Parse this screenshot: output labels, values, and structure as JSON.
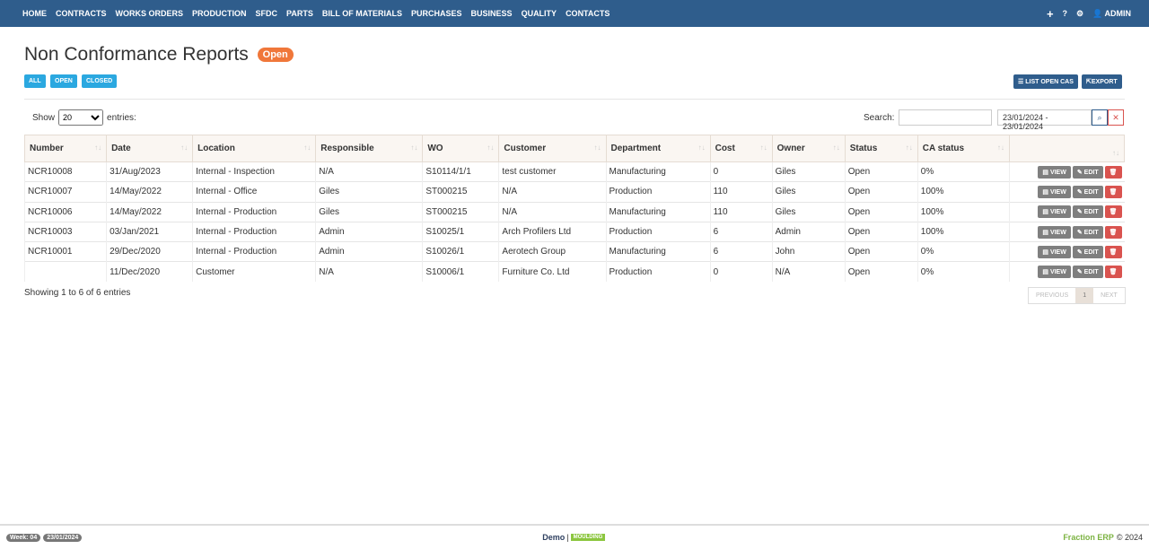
{
  "nav": {
    "items": [
      "HOME",
      "CONTRACTS",
      "WORKS ORDERS",
      "PRODUCTION",
      "SFDC",
      "PARTS",
      "BILL OF MATERIALS",
      "PURCHASES",
      "BUSINESS",
      "QUALITY",
      "CONTACTS"
    ],
    "user": "ADMIN"
  },
  "page": {
    "title": "Non Conformance Reports",
    "badge": "Open",
    "filters": [
      "ALL",
      "OPEN",
      "CLOSED"
    ],
    "list_open_cas": "LIST OPEN CAS",
    "export": "EXPORT"
  },
  "controls": {
    "show": "Show",
    "entries_value": "20",
    "entries": "entries:",
    "search": "Search:",
    "date_range": "23/01/2024 - 23/01/2024"
  },
  "table": {
    "headers": [
      "Number",
      "Date",
      "Location",
      "Responsible",
      "WO",
      "Customer",
      "Department",
      "Cost",
      "Owner",
      "Status",
      "CA status"
    ],
    "rows": [
      [
        "NCR10008",
        "31/Aug/2023",
        "Internal - Inspection",
        "N/A",
        "S10114/1/1",
        "test customer",
        "Manufacturing",
        "0",
        "Giles",
        "Open",
        "0%"
      ],
      [
        "NCR10007",
        "14/May/2022",
        "Internal - Office",
        "Giles",
        "ST000215",
        "N/A",
        "Production",
        "110",
        "Giles",
        "Open",
        "100%"
      ],
      [
        "NCR10006",
        "14/May/2022",
        "Internal - Production",
        "Giles",
        "ST000215",
        "N/A",
        "Manufacturing",
        "110",
        "Giles",
        "Open",
        "100%"
      ],
      [
        "NCR10003",
        "03/Jan/2021",
        "Internal - Production",
        "Admin",
        "S10025/1",
        "Arch Profilers Ltd",
        "Production",
        "6",
        "Admin",
        "Open",
        "100%"
      ],
      [
        "NCR10001",
        "29/Dec/2020",
        "Internal - Production",
        "Admin",
        "S10026/1",
        "Aerotech Group",
        "Manufacturing",
        "6",
        "John",
        "Open",
        "0%"
      ],
      [
        "",
        "11/Dec/2020",
        "Customer",
        "N/A",
        "S10006/1",
        "Furniture Co. Ltd",
        "Production",
        "0",
        "N/A",
        "Open",
        "0%"
      ]
    ],
    "view": "VIEW",
    "edit": "EDIT"
  },
  "info": "Showing 1 to 6 of 6 entries",
  "pagination": {
    "previous": "PREVIOUS",
    "page": "1",
    "next": "NEXT"
  },
  "footer": {
    "week": "Week: 04",
    "date": "23/01/2024",
    "demo": "Demo",
    "sep": "|",
    "module": "MOULDING",
    "brand": "Fraction ERP",
    "copy": "© 2024"
  }
}
